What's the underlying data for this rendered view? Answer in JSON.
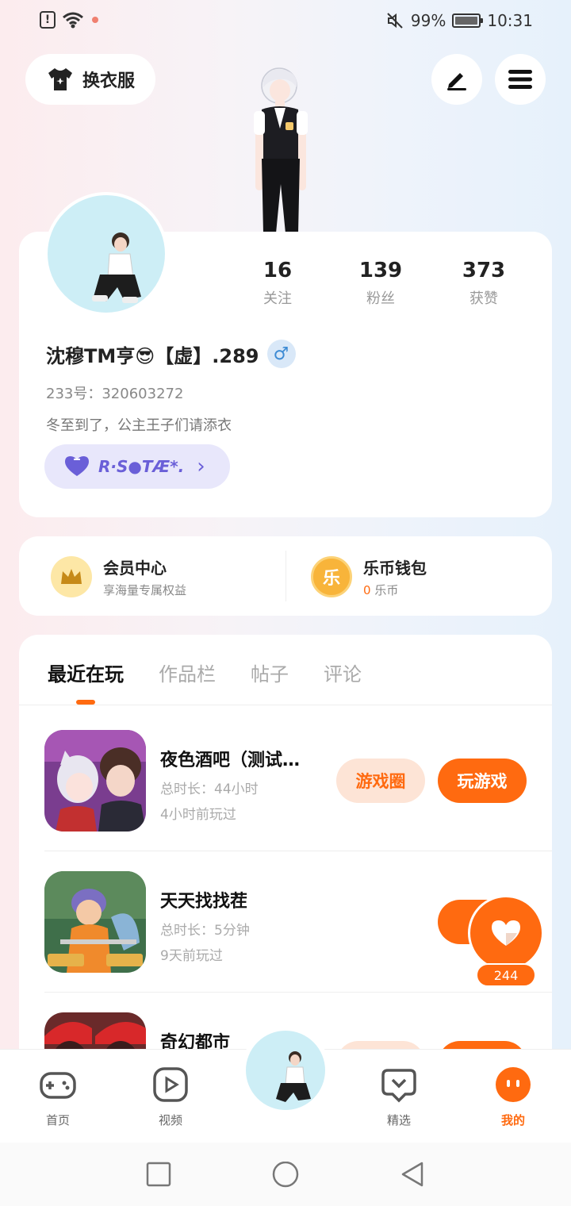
{
  "status_bar": {
    "battery_percent": "99%",
    "time": "10:31",
    "left_icons": [
      "alert-icon",
      "wifi-icon",
      "notification-dot-icon"
    ],
    "right_icons": [
      "mute-icon",
      "battery-icon"
    ]
  },
  "header": {
    "outfit_label": "换衣服",
    "edit_icon": "pen-icon",
    "menu_icon": "menu-icon"
  },
  "profile": {
    "stats": [
      {
        "value": "16",
        "label": "关注"
      },
      {
        "value": "139",
        "label": "粉丝"
      },
      {
        "value": "373",
        "label": "获赞"
      }
    ],
    "username": "沈穆TM亨😎【虚】.289",
    "gender_symbol": "♂",
    "uid": "233号：320603272",
    "bio": "冬至到了，公主王子们请添衣",
    "club_name": "R·S●TÆ*.",
    "club_arrow": "›"
  },
  "wallet": {
    "vip_title": "会员中心",
    "vip_subtitle": "享海量专属权益",
    "coin_title": "乐币钱包",
    "coin_amount": "0",
    "coin_unit": "乐币",
    "coin_glyph": "乐"
  },
  "tabs": [
    {
      "label": "最近在玩",
      "active": true
    },
    {
      "label": "作品栏",
      "active": false
    },
    {
      "label": "帖子",
      "active": false
    },
    {
      "label": "评论",
      "active": false
    }
  ],
  "games": [
    {
      "title": "夜色酒吧（测试…",
      "total_time": "总时长：44小时",
      "last_played": "4小时前玩过",
      "circle_btn": "游戏圈",
      "play_btn": "玩游戏"
    },
    {
      "title": "天天找找茬",
      "total_time": "总时长：5分钟",
      "last_played": "9天前玩过",
      "play_btn": "玩"
    },
    {
      "title": "奇幻都市"
    }
  ],
  "like": {
    "count": "244"
  },
  "bottom_nav": [
    {
      "label": "首页",
      "icon": "gamepad-icon"
    },
    {
      "label": "视频",
      "icon": "video-icon"
    },
    {
      "label": "精选",
      "icon": "heart-chat-icon"
    },
    {
      "label": "我的",
      "icon": "profile-face-icon",
      "active": true
    }
  ],
  "colors": {
    "accent": "#ff6a10",
    "accent_light": "#fde4d6",
    "club_purple": "#6a5fd8"
  }
}
